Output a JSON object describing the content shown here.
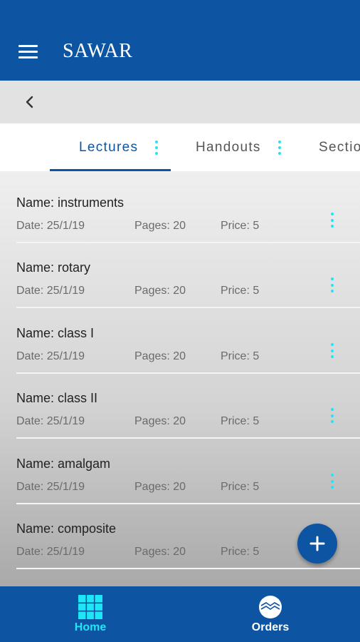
{
  "app": {
    "title": "SAWAR"
  },
  "tabs": [
    {
      "label": "Lectures",
      "active": true
    },
    {
      "label": "Handouts",
      "active": false
    },
    {
      "label": "Sections",
      "active": false
    }
  ],
  "lectures": [
    {
      "name": "Name: instruments",
      "date": "Date: 25/1/19",
      "pages": "Pages: 20",
      "price": "Price: 5"
    },
    {
      "name": "Name: rotary",
      "date": "Date: 25/1/19",
      "pages": "Pages: 20",
      "price": "Price: 5"
    },
    {
      "name": "Name: class I",
      "date": "Date: 25/1/19",
      "pages": "Pages: 20",
      "price": "Price: 5"
    },
    {
      "name": "Name: class II",
      "date": "Date: 25/1/19",
      "pages": "Pages: 20",
      "price": "Price: 5"
    },
    {
      "name": "Name: amalgam",
      "date": "Date: 25/1/19",
      "pages": "Pages: 20",
      "price": "Price: 5"
    },
    {
      "name": "Name: composite",
      "date": "Date: 25/1/19",
      "pages": "Pages: 20",
      "price": "Price: 5"
    }
  ],
  "bottom_nav": [
    {
      "label": "Home",
      "icon": "grid-icon",
      "active": true
    },
    {
      "label": "Orders",
      "icon": "orders-icon",
      "active": false
    }
  ],
  "colors": {
    "primary": "#0d55a3",
    "accent": "#1ee7f5",
    "nav_active": "#1ee7f5",
    "nav_inactive": "#ffffff"
  }
}
